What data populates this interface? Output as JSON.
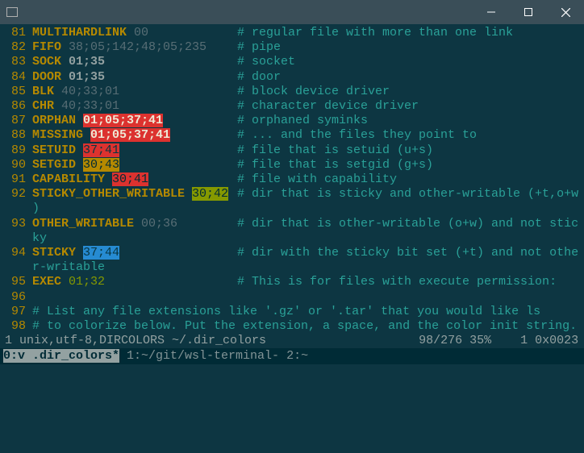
{
  "titlebar": {
    "icon_name": "terminal-icon"
  },
  "lines": [
    {
      "n": "81",
      "key": "MULTIHARDLINK",
      "val": "00",
      "style": "dim",
      "comment": "# regular file with more than one link",
      "cpos": 288
    },
    {
      "n": "82",
      "key": "FIFO",
      "val": "38;05;142;48;05;235",
      "style": "dim",
      "comment": "# pipe",
      "cpos": 288
    },
    {
      "n": "83",
      "key": "SOCK",
      "val": "01;35",
      "style": "bold",
      "comment": "# socket",
      "cpos": 288
    },
    {
      "n": "84",
      "key": "DOOR",
      "val": "01;35",
      "style": "bold",
      "comment": "# door",
      "cpos": 288
    },
    {
      "n": "85",
      "key": "BLK",
      "val": "40;33;01",
      "style": "dim",
      "comment": "# block device driver",
      "cpos": 288
    },
    {
      "n": "86",
      "key": "CHR",
      "val": "40;33;01",
      "style": "dim",
      "comment": "# character device driver",
      "cpos": 288
    },
    {
      "n": "87",
      "key": "ORPHAN",
      "val": "01;05;37;41",
      "style": "hl-red-blink",
      "comment": "# orphaned syminks",
      "cpos": 288
    },
    {
      "n": "88",
      "key": "MISSING",
      "val": "01;05;37;41",
      "style": "hl-red-blink",
      "comment": "# ... and the files they point to",
      "cpos": 288
    },
    {
      "n": "89",
      "key": "SETUID",
      "val": "37;41",
      "style": "hl-red-dark",
      "comment": "# file that is setuid (u+s)",
      "cpos": 288
    },
    {
      "n": "90",
      "key": "SETGID",
      "val": "30;43",
      "style": "hl-yellow-bk",
      "comment": "# file that is setgid (g+s)",
      "cpos": 288
    },
    {
      "n": "91",
      "key": "CAPABILITY",
      "val": "30;41",
      "style": "hl-red-bk",
      "comment": "# file with capability",
      "cpos": 288
    },
    {
      "n": "92",
      "key": "STICKY_OTHER_WRITABLE",
      "val": "30;42",
      "style": "hl-olive-bk",
      "comment": "# dir that is sticky and other-writable (+t,o+w",
      "cpos": 288,
      "wrap": ")"
    },
    {
      "n": "93",
      "key": "OTHER_WRITABLE",
      "val": "00;36",
      "style": "dim",
      "comment": "# dir that is other-writable (o+w) and not stic",
      "cpos": 288,
      "wrap": "ky"
    },
    {
      "n": "94",
      "key": "STICKY",
      "val": "37;44",
      "style": "hl-blue-dk",
      "comment": "# dir with the sticky bit set (+t) and not othe",
      "cpos": 288,
      "wrap": "r-writable"
    },
    {
      "n": "95",
      "key": "EXEC",
      "val": "01;32",
      "style": "hl-exec",
      "comment": "# This is for files with execute permission:",
      "cpos": 288
    },
    {
      "n": "96",
      "key": "",
      "val": "",
      "style": "",
      "comment": "",
      "cpos": 0
    },
    {
      "n": "97",
      "full_comment": "# List any file extensions like '.gz' or '.tar' that you would like ls"
    },
    {
      "n": "98",
      "full_comment": "# to colorize below. Put the extension, a space, and the color init string."
    }
  ],
  "status": {
    "left": "1 unix,utf-8,DIRCOLORS ~/.dir_colors",
    "right": "98/276 35%    1 0x0023"
  },
  "tmux": {
    "active": "0:v .dir_colors*",
    "rest": " 1:~/git/wsl-terminal- 2:~"
  }
}
